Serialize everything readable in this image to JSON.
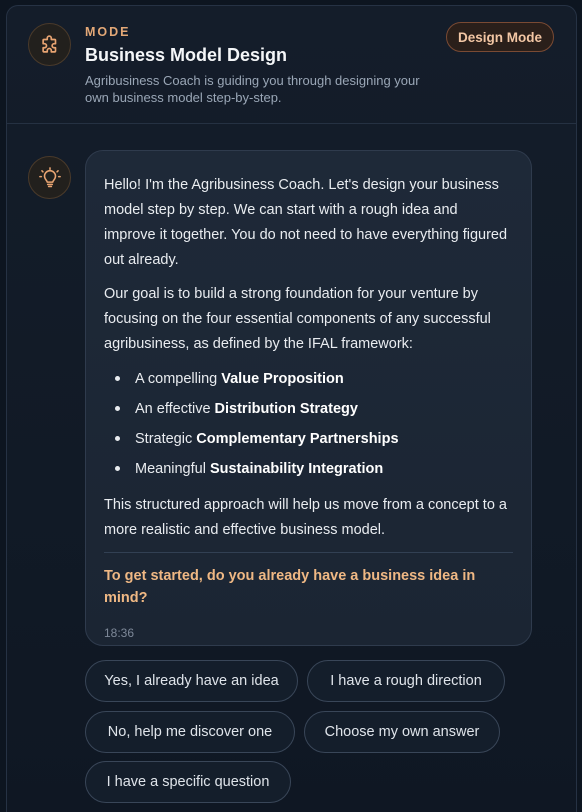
{
  "header": {
    "kicker": "MODE",
    "title": "Business Model Design",
    "description": "Agribusiness Coach is guiding you through designing your own business model step-by-step.",
    "badge": "Design Mode",
    "icon": "puzzle-icon"
  },
  "message": {
    "avatar_icon": "lightbulb-icon",
    "paragraph_1": "Hello! I'm the Agribusiness Coach. Let's design your business model step by step. We can start with a rough idea and improve it together. You do not need to have everything figured out already.",
    "paragraph_2": "Our goal is to build a strong foundation for your venture by focusing on the four essential components of any successful agribusiness, as defined by the IFAL framework:",
    "bullets": [
      {
        "prefix": "A compelling ",
        "bold": "Value Proposition"
      },
      {
        "prefix": "An effective ",
        "bold": "Distribution Strategy"
      },
      {
        "prefix": "Strategic ",
        "bold": "Complementary Partnerships"
      },
      {
        "prefix": "Meaningful ",
        "bold": "Sustainability Integration"
      }
    ],
    "paragraph_3": "This structured approach will help us move from a concept to a more realistic and effective business model.",
    "question": "To get started, do you already have a business idea in mind?",
    "timestamp": "18:36"
  },
  "quick_replies": [
    "Yes, I already have an idea",
    "I have a rough direction",
    "No, help me discover one",
    "Choose my own answer",
    "I have a specific question"
  ],
  "colors": {
    "accent": "#efb884",
    "background": "#0d1520",
    "bubble": "#1e2938"
  }
}
